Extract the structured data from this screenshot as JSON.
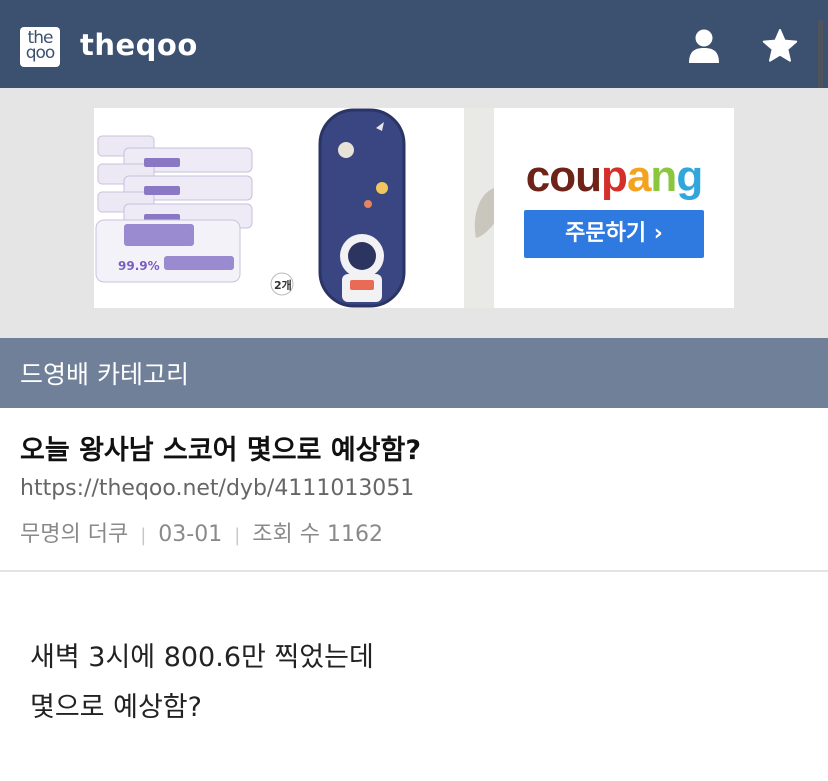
{
  "header": {
    "logo_line1": "the",
    "logo_line2": "qoo",
    "site_name": "theqoo",
    "icons": [
      "user-icon",
      "star-icon"
    ],
    "background": "#3c5170"
  },
  "ad": {
    "product1_label": "99.9%",
    "product2_label": "2개",
    "brand": [
      "c",
      "o",
      "u",
      "p",
      "a",
      "n",
      "g"
    ],
    "brand_colors": [
      "#6e2318",
      "#6e2318",
      "#6e2318",
      "#d52f2b",
      "#f4a321",
      "#8cc63e",
      "#30a6dd"
    ],
    "order_button": "주문하기 ›"
  },
  "category": {
    "label": "드영배 카테고리"
  },
  "post": {
    "title": "오늘 왕사남 스코어 몇으로 예상함?",
    "url": "https://theqoo.net/dyb/4111013051",
    "author": "무명의 더쿠",
    "date": "03-01",
    "views": "조회 수 1162",
    "body_lines": [
      "새벽 3시에 800.6만 찍었는데",
      "몇으로 예상함?"
    ]
  }
}
